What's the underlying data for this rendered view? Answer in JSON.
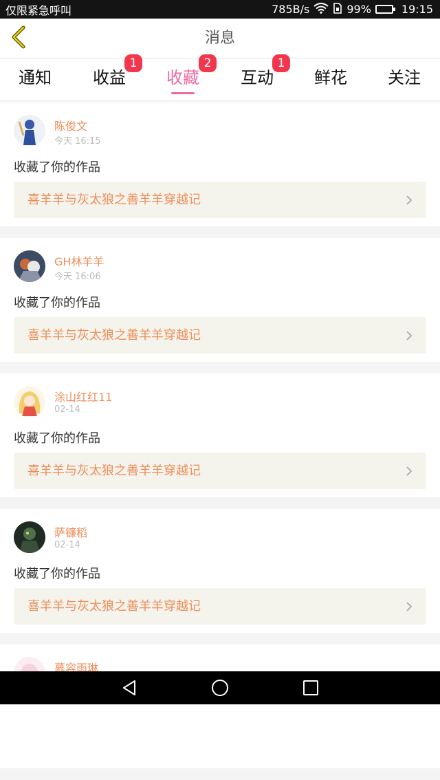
{
  "status_bar": {
    "left_text": "仅限紧急呼叫",
    "speed": "785B/s",
    "battery_percent": "99%",
    "battery_level": 0.99,
    "time": "19:15"
  },
  "header": {
    "title": "消息",
    "back_icon": "chevron-left-icon"
  },
  "tabs": [
    {
      "label": "通知",
      "badge": "",
      "active": false
    },
    {
      "label": "收益",
      "badge": "1",
      "active": false
    },
    {
      "label": "收藏",
      "badge": "2",
      "active": true
    },
    {
      "label": "互动",
      "badge": "1",
      "active": false
    },
    {
      "label": "鲜花",
      "badge": "",
      "active": false
    },
    {
      "label": "关注",
      "badge": "",
      "active": false
    }
  ],
  "feed": [
    {
      "username": "陈俊文",
      "time": "今天 16:15",
      "action": "收藏了你的作品",
      "work": "喜羊羊与灰太狼之善羊羊穿越记"
    },
    {
      "username": "GH林羊羊",
      "time": "今天 16:06",
      "action": "收藏了你的作品",
      "work": "喜羊羊与灰太狼之善羊羊穿越记"
    },
    {
      "username": "涂山红红11",
      "time": "02-14",
      "action": "收藏了你的作品",
      "work": "喜羊羊与灰太狼之善羊羊穿越记"
    },
    {
      "username": "萨镰稻",
      "time": "02-14",
      "action": "收藏了你的作品",
      "work": "喜羊羊与灰太狼之善羊羊穿越记"
    },
    {
      "username": "慕容雨琳",
      "time": "",
      "action": "",
      "work": ""
    }
  ],
  "nav_bar": {
    "back_icon": "triangle-back-icon",
    "home_icon": "circle-home-icon",
    "recents_icon": "square-recents-icon"
  },
  "colors": {
    "accent": "#ee6aa6",
    "username": "#ec8e5a",
    "badge": "#f2364c",
    "link_bg": "#f5f4ec"
  }
}
